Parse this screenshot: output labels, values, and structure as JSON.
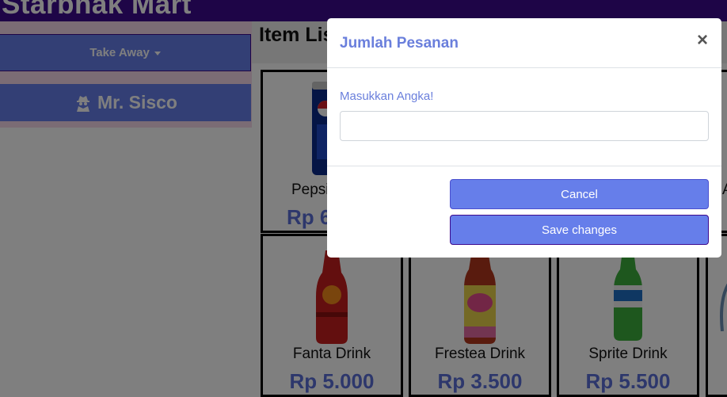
{
  "app": {
    "brand": "Starbhak Mart"
  },
  "sidebar": {
    "order_type": "Take Away",
    "user_name": "Mr. Sisco"
  },
  "main": {
    "title": "Item List",
    "products": [
      {
        "name": "Pepsi",
        "price": "Rp 6",
        "icon": "pepsi-can"
      },
      {
        "name": "Fanta Drink",
        "price": "Rp 5.000",
        "icon": "fanta-bottle"
      },
      {
        "name": "Frestea Drink",
        "price": "Rp 3.500",
        "icon": "frestea-bottle"
      },
      {
        "name": "Sprite Drink",
        "price": "Rp 5.500",
        "icon": "sprite-bottle"
      }
    ],
    "partial_letter": "A"
  },
  "modal": {
    "title": "Jumlah Pesanan",
    "close_label": "×",
    "input_label": "Masukkan Angka!",
    "input_value": "",
    "input_placeholder": "",
    "cancel_label": "Cancel",
    "save_label": "Save changes"
  },
  "colors": {
    "primary": "#667eea",
    "navbar": "#3d0a8e",
    "price": "#5a6fd8",
    "sidebar_strip": "#f6d9ea"
  }
}
